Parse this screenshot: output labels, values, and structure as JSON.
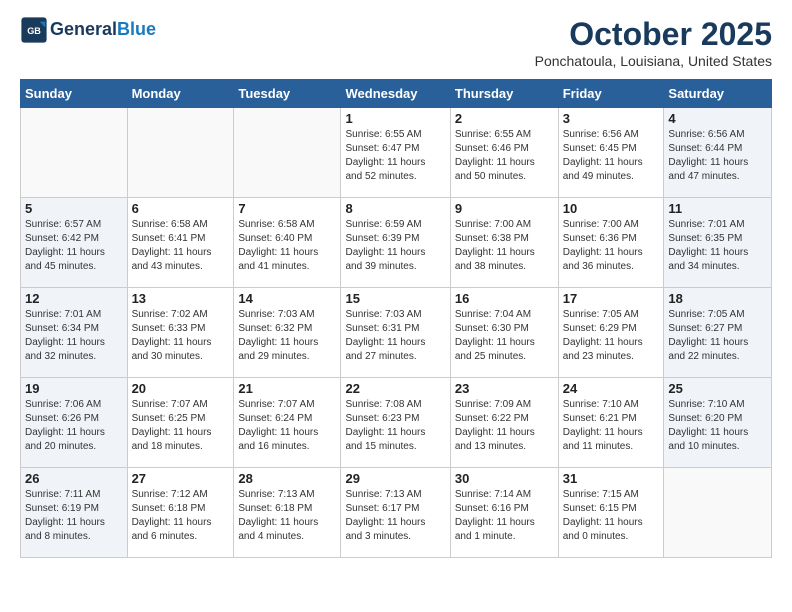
{
  "header": {
    "logo_general": "General",
    "logo_blue": "Blue",
    "month_title": "October 2025",
    "location": "Ponchatoula, Louisiana, United States"
  },
  "days_of_week": [
    "Sunday",
    "Monday",
    "Tuesday",
    "Wednesday",
    "Thursday",
    "Friday",
    "Saturday"
  ],
  "weeks": [
    [
      {
        "day": "",
        "info": ""
      },
      {
        "day": "",
        "info": ""
      },
      {
        "day": "",
        "info": ""
      },
      {
        "day": "1",
        "info": "Sunrise: 6:55 AM\nSunset: 6:47 PM\nDaylight: 11 hours\nand 52 minutes."
      },
      {
        "day": "2",
        "info": "Sunrise: 6:55 AM\nSunset: 6:46 PM\nDaylight: 11 hours\nand 50 minutes."
      },
      {
        "day": "3",
        "info": "Sunrise: 6:56 AM\nSunset: 6:45 PM\nDaylight: 11 hours\nand 49 minutes."
      },
      {
        "day": "4",
        "info": "Sunrise: 6:56 AM\nSunset: 6:44 PM\nDaylight: 11 hours\nand 47 minutes."
      }
    ],
    [
      {
        "day": "5",
        "info": "Sunrise: 6:57 AM\nSunset: 6:42 PM\nDaylight: 11 hours\nand 45 minutes."
      },
      {
        "day": "6",
        "info": "Sunrise: 6:58 AM\nSunset: 6:41 PM\nDaylight: 11 hours\nand 43 minutes."
      },
      {
        "day": "7",
        "info": "Sunrise: 6:58 AM\nSunset: 6:40 PM\nDaylight: 11 hours\nand 41 minutes."
      },
      {
        "day": "8",
        "info": "Sunrise: 6:59 AM\nSunset: 6:39 PM\nDaylight: 11 hours\nand 39 minutes."
      },
      {
        "day": "9",
        "info": "Sunrise: 7:00 AM\nSunset: 6:38 PM\nDaylight: 11 hours\nand 38 minutes."
      },
      {
        "day": "10",
        "info": "Sunrise: 7:00 AM\nSunset: 6:36 PM\nDaylight: 11 hours\nand 36 minutes."
      },
      {
        "day": "11",
        "info": "Sunrise: 7:01 AM\nSunset: 6:35 PM\nDaylight: 11 hours\nand 34 minutes."
      }
    ],
    [
      {
        "day": "12",
        "info": "Sunrise: 7:01 AM\nSunset: 6:34 PM\nDaylight: 11 hours\nand 32 minutes."
      },
      {
        "day": "13",
        "info": "Sunrise: 7:02 AM\nSunset: 6:33 PM\nDaylight: 11 hours\nand 30 minutes."
      },
      {
        "day": "14",
        "info": "Sunrise: 7:03 AM\nSunset: 6:32 PM\nDaylight: 11 hours\nand 29 minutes."
      },
      {
        "day": "15",
        "info": "Sunrise: 7:03 AM\nSunset: 6:31 PM\nDaylight: 11 hours\nand 27 minutes."
      },
      {
        "day": "16",
        "info": "Sunrise: 7:04 AM\nSunset: 6:30 PM\nDaylight: 11 hours\nand 25 minutes."
      },
      {
        "day": "17",
        "info": "Sunrise: 7:05 AM\nSunset: 6:29 PM\nDaylight: 11 hours\nand 23 minutes."
      },
      {
        "day": "18",
        "info": "Sunrise: 7:05 AM\nSunset: 6:27 PM\nDaylight: 11 hours\nand 22 minutes."
      }
    ],
    [
      {
        "day": "19",
        "info": "Sunrise: 7:06 AM\nSunset: 6:26 PM\nDaylight: 11 hours\nand 20 minutes."
      },
      {
        "day": "20",
        "info": "Sunrise: 7:07 AM\nSunset: 6:25 PM\nDaylight: 11 hours\nand 18 minutes."
      },
      {
        "day": "21",
        "info": "Sunrise: 7:07 AM\nSunset: 6:24 PM\nDaylight: 11 hours\nand 16 minutes."
      },
      {
        "day": "22",
        "info": "Sunrise: 7:08 AM\nSunset: 6:23 PM\nDaylight: 11 hours\nand 15 minutes."
      },
      {
        "day": "23",
        "info": "Sunrise: 7:09 AM\nSunset: 6:22 PM\nDaylight: 11 hours\nand 13 minutes."
      },
      {
        "day": "24",
        "info": "Sunrise: 7:10 AM\nSunset: 6:21 PM\nDaylight: 11 hours\nand 11 minutes."
      },
      {
        "day": "25",
        "info": "Sunrise: 7:10 AM\nSunset: 6:20 PM\nDaylight: 11 hours\nand 10 minutes."
      }
    ],
    [
      {
        "day": "26",
        "info": "Sunrise: 7:11 AM\nSunset: 6:19 PM\nDaylight: 11 hours\nand 8 minutes."
      },
      {
        "day": "27",
        "info": "Sunrise: 7:12 AM\nSunset: 6:18 PM\nDaylight: 11 hours\nand 6 minutes."
      },
      {
        "day": "28",
        "info": "Sunrise: 7:13 AM\nSunset: 6:18 PM\nDaylight: 11 hours\nand 4 minutes."
      },
      {
        "day": "29",
        "info": "Sunrise: 7:13 AM\nSunset: 6:17 PM\nDaylight: 11 hours\nand 3 minutes."
      },
      {
        "day": "30",
        "info": "Sunrise: 7:14 AM\nSunset: 6:16 PM\nDaylight: 11 hours\nand 1 minute."
      },
      {
        "day": "31",
        "info": "Sunrise: 7:15 AM\nSunset: 6:15 PM\nDaylight: 11 hours\nand 0 minutes."
      },
      {
        "day": "",
        "info": ""
      }
    ]
  ]
}
